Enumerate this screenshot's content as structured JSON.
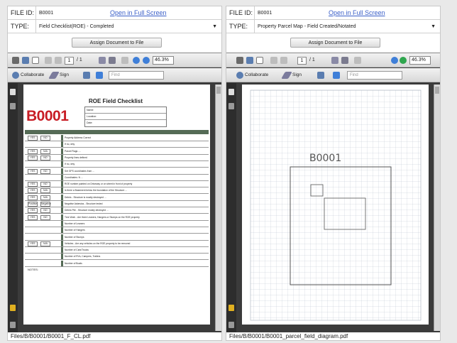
{
  "left_panel": {
    "file_id_label": "FILE ID:",
    "file_id_value": "B0001",
    "open_link": "Open in Full Screen",
    "type_label": "TYPE:",
    "type_value": "Field Checklist(ROE) - Completed",
    "assign_button": "Assign Document to File",
    "toolbar": {
      "page_current": "1",
      "page_total": "/ 1",
      "zoom": "46.3%",
      "collaborate": "Collaborate",
      "sign": "Sign",
      "find_placeholder": "Find"
    },
    "file_path": "Files/B/B0001/B0001_F_CL.pdf",
    "document": {
      "title": "ROE Field Checklist",
      "id": "B0001",
      "header_lines": [
        "Name:",
        "Location:",
        "Date:"
      ],
      "rows": [
        {
          "a": "YES",
          "b": "NO",
          "text": "Property Address Correct"
        },
        {
          "a": "",
          "b": "",
          "text": "If no, why"
        },
        {
          "a": "YES",
          "b": "N/A",
          "text": "Parcel Flags ...."
        },
        {
          "a": "YES",
          "b": "NO",
          "text": "Property lines defined"
        },
        {
          "a": "",
          "b": "",
          "text": "If no, why"
        },
        {
          "a": "YES",
          "b": "NO",
          "text": "Set GPS coordinates from ..."
        },
        {
          "a": "",
          "b": "",
          "text": "Coordinates: N ..."
        },
        {
          "a": "YES",
          "b": "NO",
          "text": "ROE number painted on Driveway or on street in front of property"
        },
        {
          "a": "YES",
          "b": "N/A",
          "text": "Is there a Basement below the foundation of the Structure ..."
        },
        {
          "a": "YES",
          "b": "N/A",
          "text": "Debris - Structure is mostly destroyed ..."
        },
        {
          "a": "Positive",
          "b": "Negative",
          "text": "Negative Asbestos - Structure tested"
        },
        {
          "a": "YES",
          "b": "NO",
          "text": "Debris Pile - Structure mostly destroyed ..."
        },
        {
          "a": "YES",
          "b": "NO",
          "text": "Tree Work - Are there Leaners, Hangers or Stumps on the ROE property"
        },
        {
          "a": "",
          "b": "",
          "text": "Number of Leaners"
        },
        {
          "a": "",
          "b": "",
          "text": "Number of Hangers"
        },
        {
          "a": "",
          "b": "",
          "text": "Number of Stumps"
        },
        {
          "a": "YES",
          "b": "N/A",
          "text": "Vehicles - Are any vehicles on the ROE property to be removed"
        },
        {
          "a": "",
          "b": "",
          "text": "Number of Cars/Trucks"
        },
        {
          "a": "",
          "b": "",
          "text": "Number of RVs, Campers, Trailers"
        },
        {
          "a": "",
          "b": "",
          "text": "Number of Boats"
        }
      ],
      "notes_label": "NOTES:"
    }
  },
  "right_panel": {
    "file_id_label": "FILE ID:",
    "file_id_value": "B0001",
    "open_link": "Open in Full Screen",
    "type_label": "TYPE:",
    "type_value": "Property Parcel Map - Field Created/Notated",
    "assign_button": "Assign Document to File",
    "toolbar": {
      "page_current": "1",
      "page_total": "/ 1",
      "zoom": "46.3%",
      "collaborate": "Collaborate",
      "sign": "Sign",
      "find_placeholder": "Find"
    },
    "file_path": "Files/B/B0001/B0001_parcel_field_diagram.pdf",
    "document": {
      "handwritten_label": "B0001"
    }
  }
}
